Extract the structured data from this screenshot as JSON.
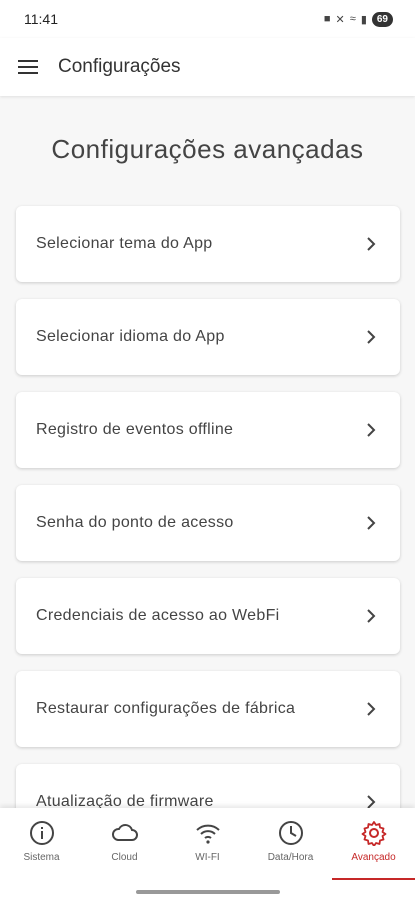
{
  "status_bar": {
    "time": "11:41",
    "battery": "69"
  },
  "app_bar": {
    "title": "Configurações"
  },
  "page": {
    "heading": "Configurações avançadas"
  },
  "menu_items": [
    {
      "label": "Selecionar tema do App"
    },
    {
      "label": "Selecionar idioma do App"
    },
    {
      "label": "Registro de eventos offline"
    },
    {
      "label": "Senha do ponto de acesso"
    },
    {
      "label": "Credenciais de acesso ao WebFi"
    },
    {
      "label": "Restaurar configurações de fábrica"
    },
    {
      "label": "Atualização de firmware"
    }
  ],
  "bottom_nav": {
    "active": "Avançado",
    "accent_color": "#c62828",
    "tabs": [
      {
        "label": "Sistema",
        "icon": "info-icon"
      },
      {
        "label": "Cloud",
        "icon": "cloud-icon"
      },
      {
        "label": "WI-FI",
        "icon": "wifi-icon"
      },
      {
        "label": "Data/Hora",
        "icon": "clock-icon"
      },
      {
        "label": "Avançado",
        "icon": "gear-icon"
      }
    ]
  }
}
